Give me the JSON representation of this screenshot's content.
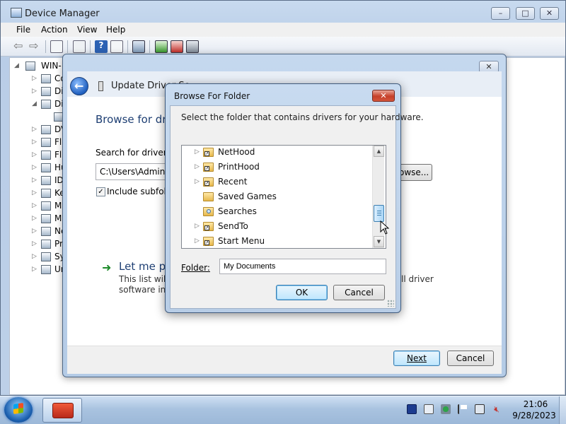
{
  "device_manager": {
    "title": "Device Manager",
    "menu": [
      "File",
      "Action",
      "View",
      "Help"
    ],
    "tree_root": "WIN-",
    "tree_items": [
      "Co",
      "Di",
      "Di",
      "DV",
      "Fl",
      "Fl",
      "Hu",
      "ID",
      "Ke",
      "M",
      "M",
      "Ne",
      "Pr",
      "Sy",
      "Ur"
    ]
  },
  "wizard": {
    "title": "Update Driver So",
    "heading": "Browse for dri",
    "search_label": "Search for driver so",
    "path_value": "C:\\Users\\Adminis",
    "browse_label": "owse...",
    "include_subfolders_label": "Include subfold",
    "include_subfolders_checked": true,
    "letme_link": "Let me pi",
    "letme_desc_1": "This list will s",
    "letme_desc_1b": "ll driver",
    "letme_desc_2": "software in t",
    "next_label": "Next",
    "cancel_label": "Cancel"
  },
  "browse_dialog": {
    "title": "Browse For Folder",
    "instruction": "Select the folder that contains drivers for your hardware.",
    "folders": [
      {
        "name": "NetHood",
        "expandable": true,
        "icon": "folder-shortcut-icon"
      },
      {
        "name": "PrintHood",
        "expandable": true,
        "icon": "folder-shortcut-icon"
      },
      {
        "name": "Recent",
        "expandable": true,
        "icon": "folder-shortcut-icon"
      },
      {
        "name": "Saved Games",
        "expandable": false,
        "icon": "folder-icon"
      },
      {
        "name": "Searches",
        "expandable": false,
        "icon": "search-folder-icon"
      },
      {
        "name": "SendTo",
        "expandable": true,
        "icon": "folder-shortcut-icon"
      },
      {
        "name": "Start Menu",
        "expandable": true,
        "icon": "folder-shortcut-icon"
      }
    ],
    "folder_label": "Folder:",
    "folder_value": "My Documents",
    "ok_label": "OK",
    "cancel_label": "Cancel",
    "close_glyph": "✕"
  },
  "taskbar": {
    "time": "21:06",
    "date": "9/28/2023"
  },
  "colors": {
    "wizard_heading": "#1e3f73",
    "close_red": "#c6402a",
    "default_button_border": "#3c7fb1"
  }
}
